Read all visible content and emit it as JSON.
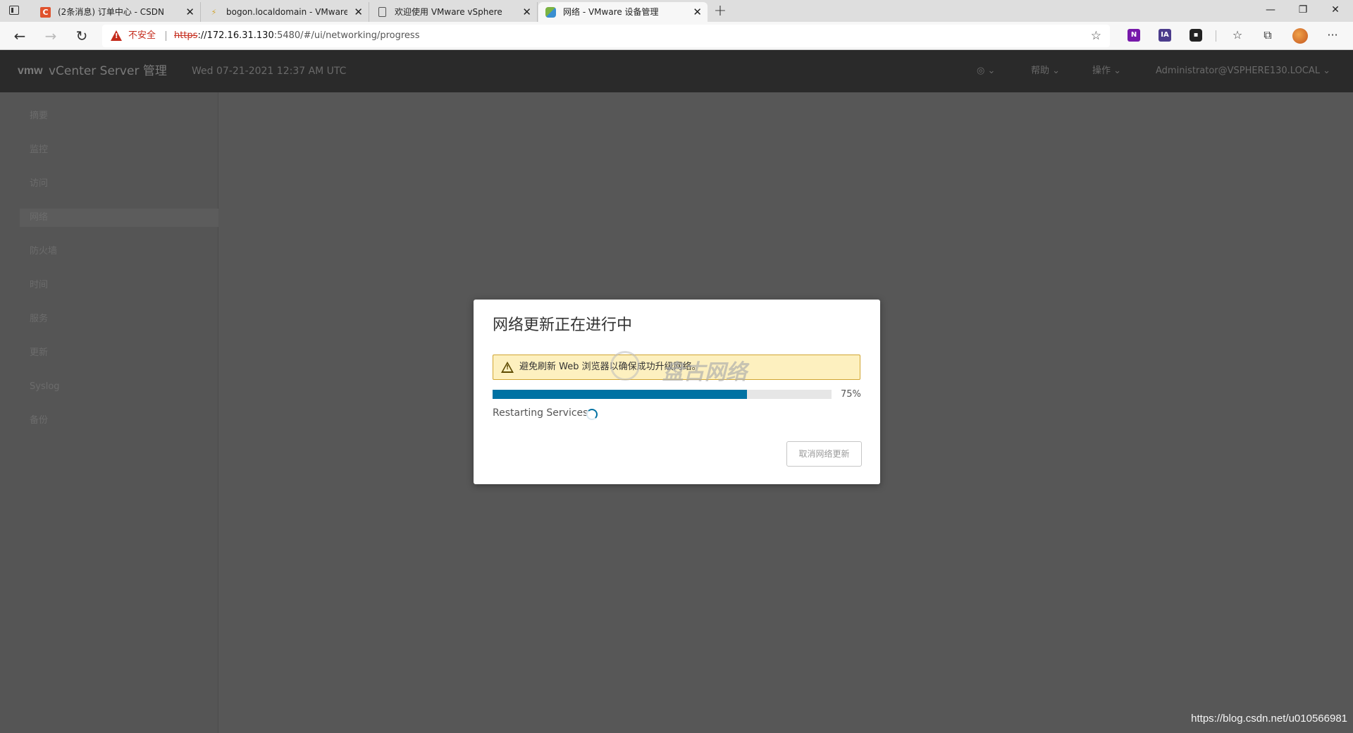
{
  "browser": {
    "tabs": [
      {
        "title": "(2条消息) 订单中心 - CSDN",
        "favicon": "csdn-icon",
        "active": false
      },
      {
        "title": "bogon.localdomain - VMware ESXi",
        "favicon": "vmware-esxi-icon",
        "active": false
      },
      {
        "title": "欢迎使用 VMware vSphere",
        "favicon": "page-icon",
        "active": false
      },
      {
        "title": "网络 - VMware 设备管理",
        "favicon": "vmware-appliance-icon",
        "active": true
      }
    ],
    "security_label": "不安全",
    "url_scheme": "https",
    "url_host": "://172.16.31.130",
    "url_path": ":5480/#/ui/networking/progress",
    "extensions": [
      "onenote-icon",
      "ia-icon",
      "reader-icon"
    ],
    "colors": {
      "insecure": "#c42b1c",
      "tab_strip": "#dedede"
    }
  },
  "vc_header": {
    "logo": "vmw",
    "app_title": "vCenter Server 管理",
    "datetime": "Wed 07-21-2021 12:37 AM UTC",
    "menu_help": "帮助",
    "menu_actions": "操作",
    "user": "Administrator@VSPHERE130.LOCAL"
  },
  "sidebar": {
    "items": [
      {
        "label": "摘要"
      },
      {
        "label": "监控"
      },
      {
        "label": "访问"
      },
      {
        "label": "网络",
        "selected": true
      },
      {
        "label": "防火墙"
      },
      {
        "label": "时间"
      },
      {
        "label": "服务"
      },
      {
        "label": "更新"
      },
      {
        "label": "Syslog"
      },
      {
        "label": "备份"
      }
    ]
  },
  "modal": {
    "title": "网络更新正在进行中",
    "alert_text": "避免刷新 Web 浏览器以确保成功升级网络。",
    "progress_percent": 75,
    "progress_label": "75%",
    "status": "Restarting Services",
    "cancel_button": "取消网络更新",
    "accent_color": "#0072a3"
  },
  "watermarks": {
    "overlay_text": "盘古网络",
    "blog_url": "https://blog.csdn.net/u010566981"
  }
}
